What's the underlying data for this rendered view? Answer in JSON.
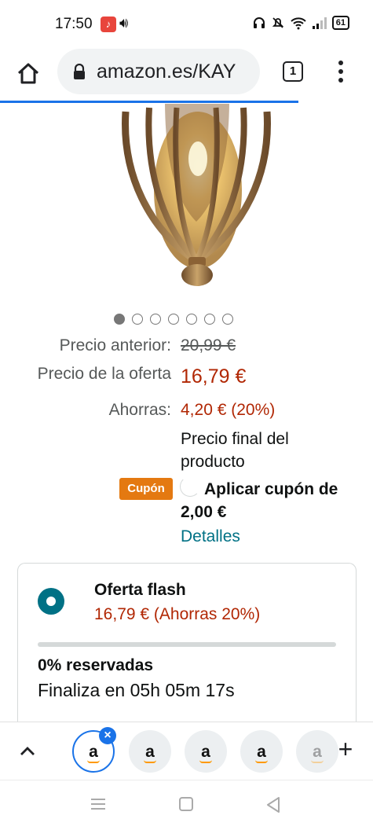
{
  "status_bar": {
    "time": "17:50",
    "battery": "61",
    "icons": [
      "music-icon",
      "volume-icon",
      "headphones-icon",
      "mute-icon",
      "wifi-icon",
      "signal-icon",
      "battery-icon"
    ]
  },
  "browser": {
    "url": "amazon.es/KAY",
    "tab_count": "1",
    "load_progress": 0.8,
    "accent": "#1a73e8"
  },
  "carousel": {
    "total": 7,
    "active_index": 0
  },
  "pricing": {
    "previous_label": "Precio anterior:",
    "previous_value": "20,99 €",
    "deal_label": "Precio de la oferta",
    "deal_value": "16,79 €",
    "savings_label": "Ahorras:",
    "savings_value": "4,20 € (20%)",
    "final_note": "Precio final del producto",
    "price_color": "#b12704"
  },
  "coupon": {
    "badge": "Cupón",
    "text": "Aplicar cupón de 2,00 €",
    "details_link": "Detalles",
    "badge_color": "#e47911"
  },
  "flash_deal": {
    "title": "Oferta flash",
    "price": "16,79 € (Ahorras 20%)",
    "claimed_text": "0% reservadas",
    "claimed_fraction": 0.0,
    "ends_text": "Finaliza en 05h 05m 17s",
    "accent": "#007185"
  },
  "tab_strip": {
    "tabs": [
      {
        "glyph": "a",
        "active": true
      },
      {
        "glyph": "a",
        "active": false
      },
      {
        "glyph": "a",
        "active": false
      },
      {
        "glyph": "a",
        "active": false
      },
      {
        "glyph": "a",
        "active": false
      }
    ],
    "close_glyph": "×",
    "new_tab_glyph": "+"
  }
}
